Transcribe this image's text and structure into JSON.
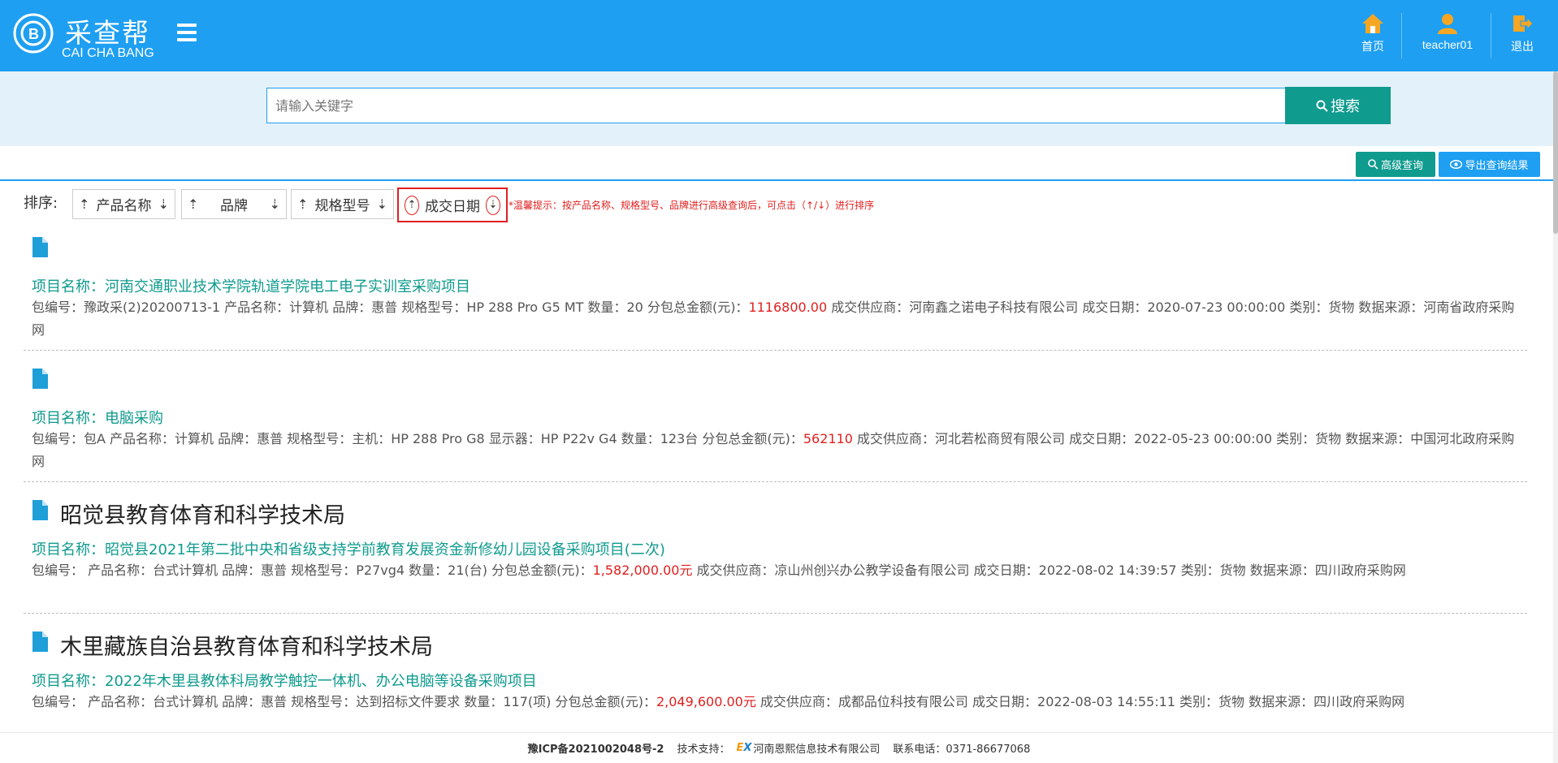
{
  "header": {
    "logo_cn": "采查帮",
    "logo_en": "CAI CHA BANG",
    "nav": [
      {
        "label": "首页",
        "icon": "home-icon"
      },
      {
        "label": "teacher01",
        "icon": "user-icon"
      },
      {
        "label": "退出",
        "icon": "logout-icon"
      }
    ]
  },
  "search": {
    "placeholder": "请输入关键字",
    "button_label": "搜索"
  },
  "tools": {
    "advanced_label": "高级查询",
    "export_label": "导出查询结果"
  },
  "sort": {
    "label": "排序:",
    "fields": [
      "产品名称",
      "品牌",
      "规格型号",
      "成交日期"
    ],
    "up_arrow": "⇡",
    "down_arrow": "⇣",
    "tip": "*温馨提示：按产品名称、规格型号、品牌进行高级查询后，可点击（↑/↓）进行排序"
  },
  "results": [
    {
      "org": "",
      "project": "项目名称：河南交通职业技术学院轨道学院电工电子实训室采购项目",
      "detail_pre": "包编号：豫政采(2)20200713-1  产品名称：计算机  品牌：惠普  规格型号：HP 288 Pro G5 MT  数量：20  分包总金额(元)：",
      "amount": "1116800.00",
      "detail_post": "  成交供应商：河南鑫之诺电子科技有限公司  成交日期：2020-07-23 00:00:00  类别：货物  数据来源：河南省政府采购网"
    },
    {
      "org": "",
      "project": "项目名称：电脑采购",
      "detail_pre": "包编号：包A  产品名称：计算机  品牌：惠普  规格型号：主机：HP 288 Pro G8 显示器：HP P22v G4  数量：123台  分包总金额(元)：",
      "amount": "562110",
      "detail_post": "  成交供应商：河北若松商贸有限公司  成交日期：2022-05-23 00:00:00  类别：货物  数据来源：中国河北政府采购网"
    },
    {
      "org": "昭觉县教育体育和科学技术局",
      "project": "项目名称：昭觉县2021年第二批中央和省级支持学前教育发展资金新修幼儿园设备采购项目(二次)",
      "detail_pre": "包编号：  产品名称：台式计算机  品牌：惠普  规格型号：P27vg4  数量：21(台)  分包总金额(元)：",
      "amount": "1,582,000.00元",
      "detail_post": "  成交供应商：凉山州创兴办公教学设备有限公司  成交日期：2022-08-02 14:39:57  类别：货物  数据来源：四川政府采购网"
    },
    {
      "org": "木里藏族自治县教育体育和科学技术局",
      "project": "项目名称：2022年木里县教体科局教学触控一体机、办公电脑等设备采购项目",
      "detail_pre": "包编号：  产品名称：台式计算机  品牌：惠普  规格型号：达到招标文件要求  数量：117(项)  分包总金额(元)：",
      "amount": "2,049,600.00元",
      "detail_post": "  成交供应商：成都品位科技有限公司  成交日期：2022-08-03 14:55:11  类别：货物  数据来源：四川政府采购网"
    }
  ],
  "footer": {
    "icp": "豫ICP备2021002048号-2",
    "support_label": "技术支持：",
    "company": "河南恩熙信息技术有限公司",
    "phone": "联系电话：0371-86677068"
  },
  "colors": {
    "header_bg": "#1e9ff2",
    "accent_teal": "#0f9b8e",
    "amount_red": "#e02020"
  }
}
